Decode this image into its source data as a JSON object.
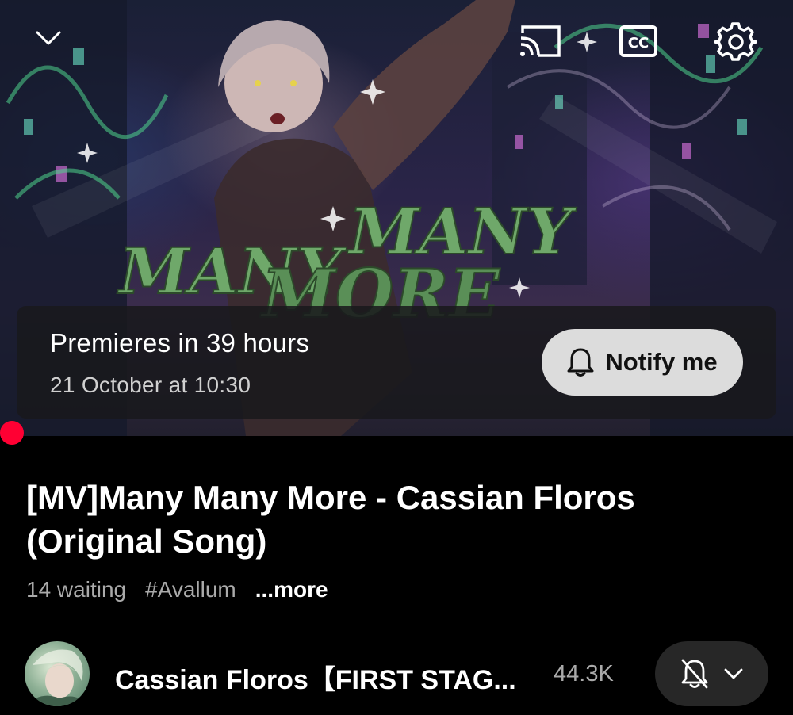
{
  "player": {
    "artwork_title": "MANY MANY MORE",
    "controls": {
      "collapse": "chevron-down-icon",
      "cast": "cast-icon",
      "captions": "CC",
      "settings": "gear-icon"
    },
    "premiere": {
      "title": "Premieres in 39 hours",
      "date": "21 October at 10:30",
      "notify_label": "Notify me"
    },
    "progress_color": "#ff0033"
  },
  "video": {
    "title": "[MV]Many Many More - Cassian Floros (Original Song)",
    "waiting": "14 waiting",
    "hashtag": "#Avallum",
    "more": "...more"
  },
  "channel": {
    "name": "Cassian Floros【FIRST STAG...",
    "subscribers": "44.3K",
    "subscribe_icon": "bell-off-icon"
  }
}
